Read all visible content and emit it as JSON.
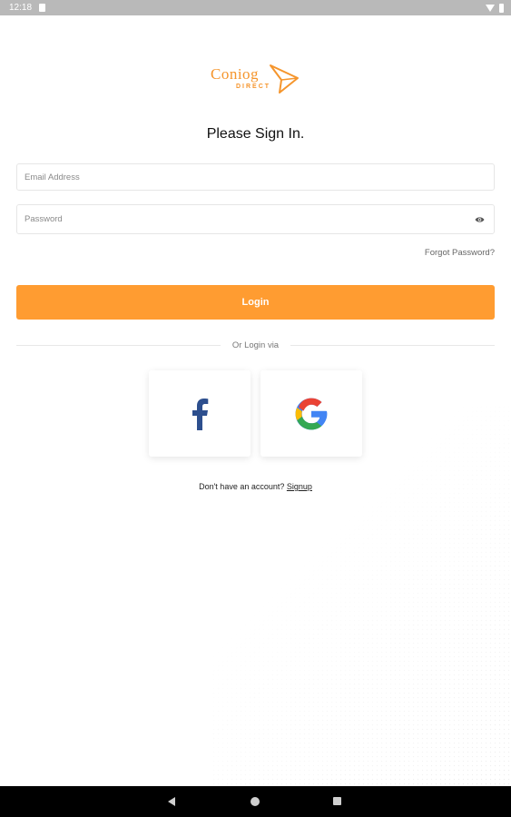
{
  "status_bar": {
    "time": "12:18"
  },
  "logo": {
    "main": "Coniog",
    "sub": "DIRECT"
  },
  "title": "Please Sign In.",
  "form": {
    "email_placeholder": "Email Address",
    "password_placeholder": "Password",
    "forgot_label": "Forgot Password?",
    "login_label": "Login"
  },
  "divider": {
    "text": "Or Login via"
  },
  "social": {
    "facebook_icon": "facebook-icon",
    "google_icon": "google-icon"
  },
  "signup": {
    "prompt": "Don't have an account?",
    "link": "Signup"
  },
  "colors": {
    "accent": "#ff9c31",
    "logo": "#f5952c",
    "facebook": "#3b5998"
  }
}
